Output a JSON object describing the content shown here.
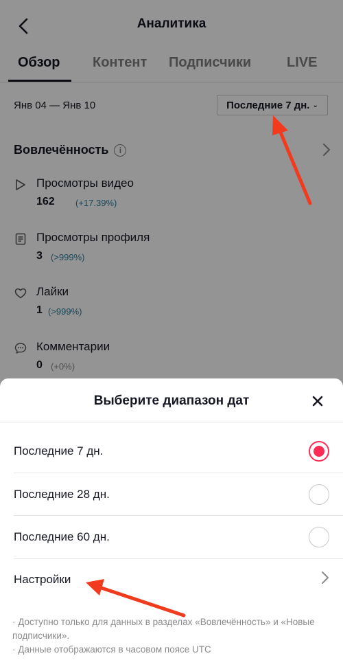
{
  "nav": {
    "title": "Аналитика",
    "back_icon": "chevron-left-icon"
  },
  "tabs": [
    {
      "label": "Обзор",
      "active": true
    },
    {
      "label": "Контент",
      "active": false
    },
    {
      "label": "Подписчики",
      "active": false
    },
    {
      "label": "LIVE",
      "active": false
    }
  ],
  "range": {
    "dates": "Янв 04 — Янв 10",
    "selected": "Последние 7 дн.",
    "chev": "⌄"
  },
  "engagement": {
    "title": "Вовлечённость",
    "info_icon_text": "i",
    "metrics": [
      {
        "icon": "play-icon",
        "label": "Просмотры видео",
        "value": "162",
        "delta": "(+17.39%)"
      },
      {
        "icon": "profile-doc-icon",
        "label": "Просмотры профиля",
        "value": "3",
        "delta": "(>999%)"
      },
      {
        "icon": "heart-icon",
        "label": "Лайки",
        "value": "1",
        "delta": "(>999%)"
      },
      {
        "icon": "comment-icon",
        "label": "Комментарии",
        "value": "0",
        "delta": "(+0%)"
      }
    ]
  },
  "sheet": {
    "title": "Выберите диапазон дат",
    "options": [
      {
        "label": "Последние 7 дн.",
        "selected": true
      },
      {
        "label": "Последние 28 дн.",
        "selected": false
      },
      {
        "label": "Последние 60 дн.",
        "selected": false
      }
    ],
    "settings_label": "Настройки",
    "notes": [
      "· Доступно только для данных в разделах «Вовлечённость» и «Новые подписчики».",
      "· Данные отображаются в часовом поясе UTC"
    ]
  },
  "colors": {
    "accent": "#fe2c55",
    "annotation_arrow": "#f23b1e",
    "delta_positive": "#2b7c9e"
  }
}
